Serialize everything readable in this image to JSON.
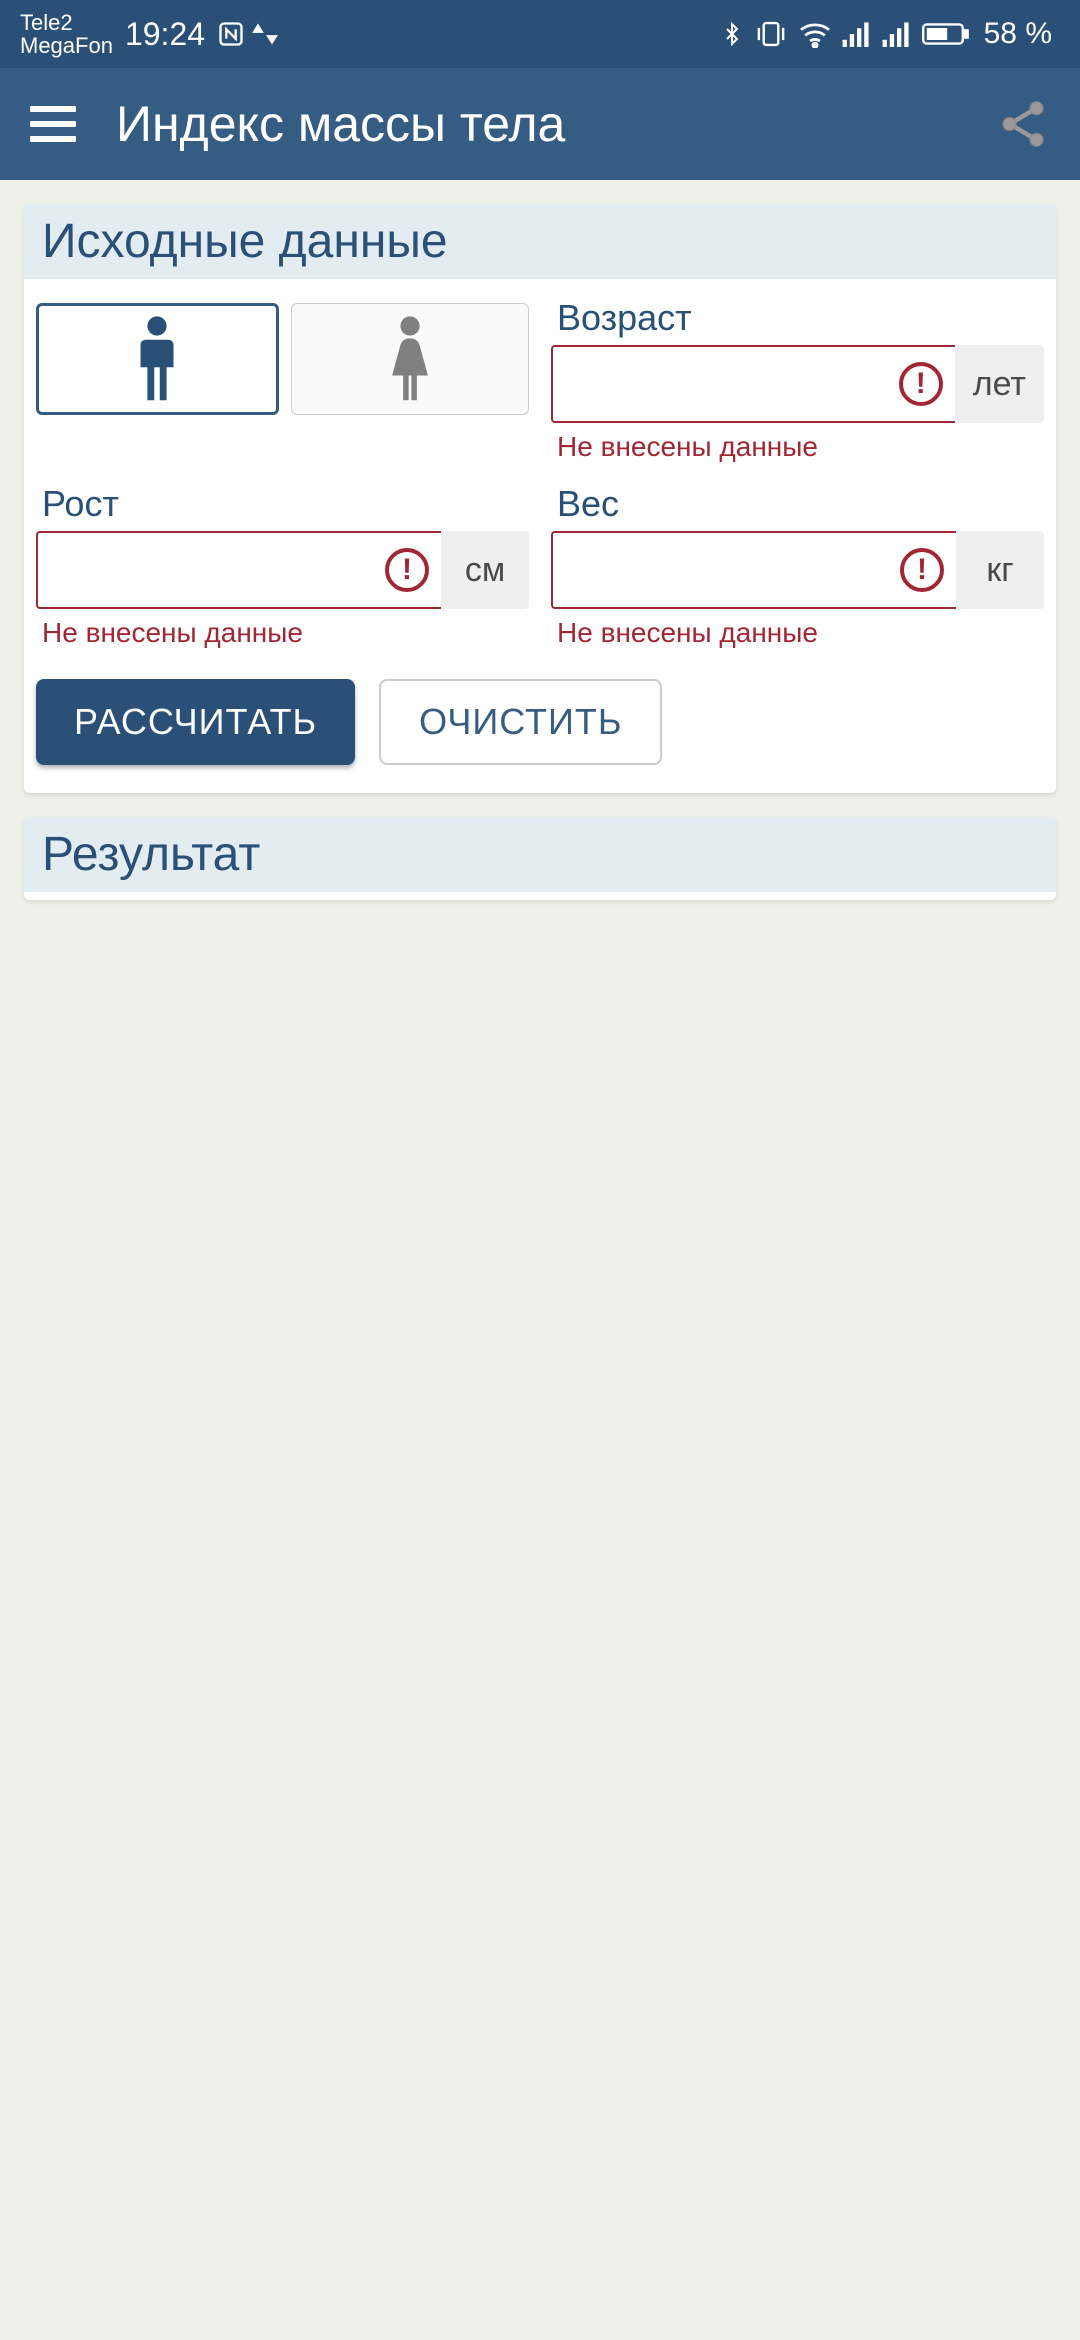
{
  "statusbar": {
    "carrier1": "Tele2",
    "carrier2": "MegaFon",
    "time": "19:24",
    "battery_pct": "58 %"
  },
  "header": {
    "title": "Индекс массы тела"
  },
  "card_input": {
    "title": "Исходные данные",
    "age": {
      "label": "Возраст",
      "unit": "лет",
      "error": "Не внесены данные"
    },
    "height": {
      "label": "Рост",
      "unit": "см",
      "error": "Не внесены данные"
    },
    "weight": {
      "label": "Вес",
      "unit": "кг",
      "error": "Не внесены данные"
    },
    "calc_btn": "РАССЧИТАТЬ",
    "clear_btn": "ОЧИСТИТЬ"
  },
  "card_result": {
    "title": "Результат"
  },
  "colors": {
    "primary": "#355c82",
    "primary_dark": "#2a5078",
    "error": "#a02733",
    "header_bg": "#e3ecf1"
  }
}
